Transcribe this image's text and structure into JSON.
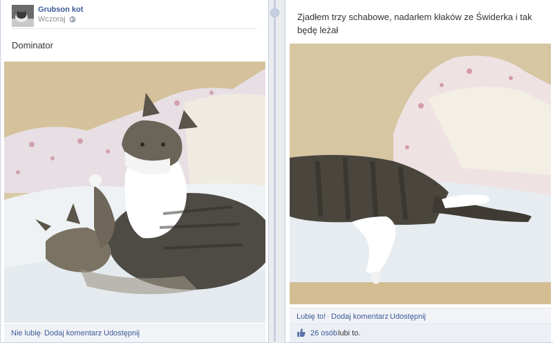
{
  "colors": {
    "link": "#3b5998",
    "spine": "#c6cfe1",
    "bar": "#f2f3f7"
  },
  "left_post": {
    "author": "Grubson kot",
    "time": "Wczoraj",
    "privacy_icon": "globe-icon",
    "text": "Dominator",
    "photo_icon": "photo-cats-on-bed",
    "actions": {
      "like": "Nie lubię",
      "comment": "Dodaj komentarz",
      "share": "Udostępnij",
      "sep": "·"
    }
  },
  "right_post": {
    "text": "Zjadłem trzy schabowe, nadarłem kłaków ze Świderka i tak będę leżał",
    "photo_icon": "photo-cat-lying-on-bed",
    "actions": {
      "like": "Lubię to!",
      "comment": "Dodaj komentarz",
      "share": "Udostępnij",
      "sep": "·"
    },
    "likes": {
      "icon": "thumbs-up-icon",
      "count": "26 osób",
      "suffix": "lubi to."
    }
  }
}
